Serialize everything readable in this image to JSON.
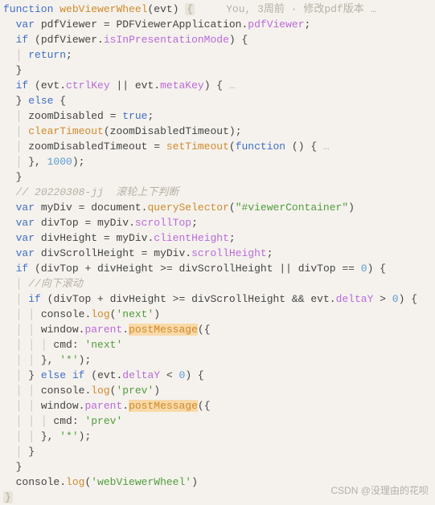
{
  "annotation": "You, 3周前 · 修改pdf版本 …",
  "tokens": {
    "function": "function",
    "webViewerWheel": "webViewerWheel",
    "evt": "evt",
    "var": "var",
    "pdfViewer": "pdfViewer",
    "PDFViewerApplication": "PDFViewerApplication",
    "dot_pdfViewer": "pdfViewer",
    "if": "if",
    "isInPresentationMode": "isInPresentationMode",
    "return": "return",
    "ctrlKey": "ctrlKey",
    "metaKey": "metaKey",
    "else": "else",
    "zoomDisabled": "zoomDisabled",
    "true": "true",
    "clearTimeout": "clearTimeout",
    "zoomDisabledTimeout": "zoomDisabledTimeout",
    "setTimeout": "setTimeout",
    "thousand": "1000",
    "cmt1": "// 20220308-jj  滚轮上下判断",
    "myDiv": "myDiv",
    "document": "document",
    "querySelector": "querySelector",
    "qs_arg": "\"#viewerContainer\"",
    "divTop": "divTop",
    "scrollTop": "scrollTop",
    "divHeight": "divHeight",
    "clientHeight": "clientHeight",
    "divScrollHeight": "divScrollHeight",
    "scrollHeight": "scrollHeight",
    "zero": "0",
    "cmt2": "//向下滚动",
    "deltaY": "deltaY",
    "console": "console",
    "log": "log",
    "next_s": "'next'",
    "prev_s": "'prev'",
    "window": "window",
    "parent": "parent",
    "postMessage": "postMessage",
    "cmd": "cmd",
    "next_v": "'next'",
    "prev_v": "'prev'",
    "star": "'*'",
    "wvw_s": "'webViewerWheel'"
  },
  "watermark": "CSDN @没理由的花呗"
}
